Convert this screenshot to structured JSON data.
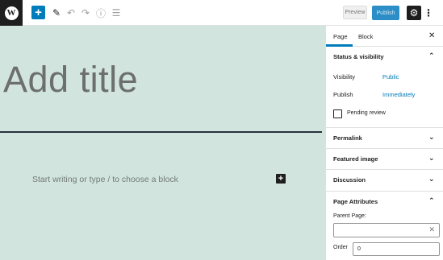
{
  "toolbar": {
    "logo_glyph": "W",
    "add_glyph": "+",
    "preview_label": "Preview",
    "publish_label": "Publish",
    "settings_glyph": "⚙",
    "more_glyph": "⋮",
    "pencil_glyph": "✎",
    "undo_glyph": "↶",
    "redo_glyph": "↷",
    "info_glyph": "ⓘ",
    "outline_glyph": "☰"
  },
  "editor": {
    "title_placeholder": "Add title",
    "block_placeholder": "Start writing or type / to choose a block",
    "inline_add_glyph": "+",
    "background_color": "#d1e4dd"
  },
  "sidebar": {
    "tabs": [
      {
        "label": "Page",
        "active": true
      },
      {
        "label": "Block",
        "active": false
      }
    ],
    "close_glyph": "✕",
    "status_visibility": {
      "title": "Status & visibility",
      "expanded": true,
      "visibility_label": "Visibility",
      "visibility_value": "Public",
      "publish_label": "Publish",
      "publish_value": "Immediately",
      "pending_review_label": "Pending review",
      "pending_review_checked": false
    },
    "panels": [
      {
        "title": "Permalink",
        "expanded": false
      },
      {
        "title": "Featured image",
        "expanded": false
      },
      {
        "title": "Discussion",
        "expanded": false
      }
    ],
    "page_attributes": {
      "title": "Page Attributes",
      "expanded": true,
      "parent_page_label": "Parent Page:",
      "parent_page_value": "",
      "order_label": "Order",
      "order_value": "0"
    },
    "chevron_up": "⌃",
    "chevron_down": "⌄",
    "clear_glyph": "✕"
  },
  "colors": {
    "accent": "#007cba",
    "dark": "#1e1e1e"
  }
}
